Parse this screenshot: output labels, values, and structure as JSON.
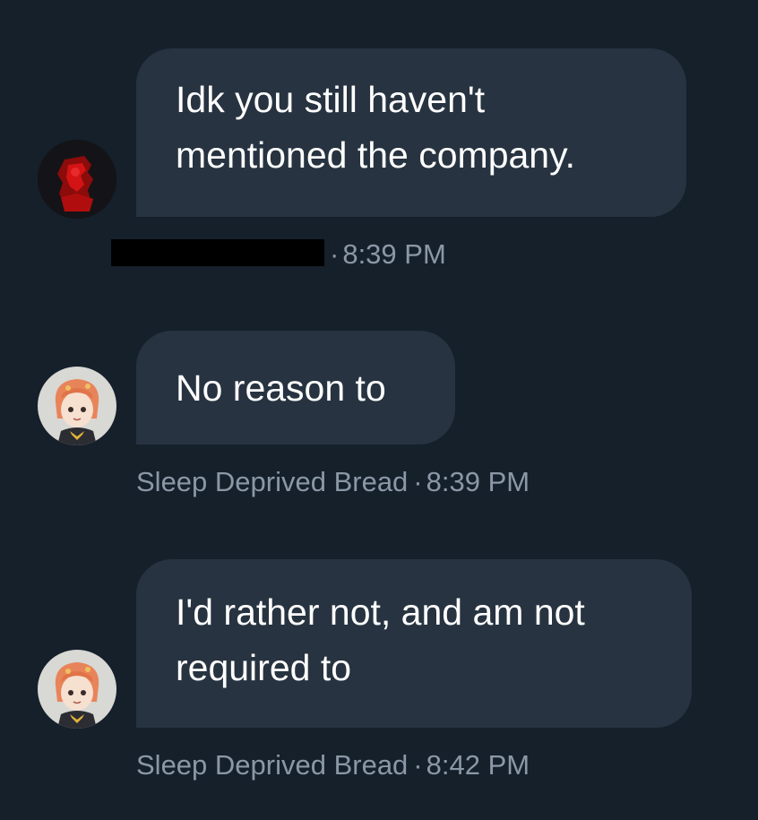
{
  "conversation": {
    "messages": [
      {
        "text": "Idk you still haven't\nmentioned the company.",
        "sender": "",
        "time": "8:39 PM",
        "sender_redacted": true,
        "avatar_icon": "red-dark-avatar-icon"
      },
      {
        "text": "No reason to",
        "sender": "Sleep Deprived Bread",
        "time": "8:39 PM",
        "sender_redacted": false,
        "avatar_icon": "orange-hair-character-avatar-icon"
      },
      {
        "text": "I'd rather not, and am not\nrequired to",
        "sender": "Sleep Deprived Bread",
        "time": "8:42 PM",
        "sender_redacted": false,
        "avatar_icon": "orange-hair-character-avatar-icon"
      }
    ],
    "separator": "·"
  },
  "colors": {
    "background": "#15202b",
    "bubble": "#273340",
    "text": "#ffffff",
    "meta_text": "#8b98a5"
  }
}
